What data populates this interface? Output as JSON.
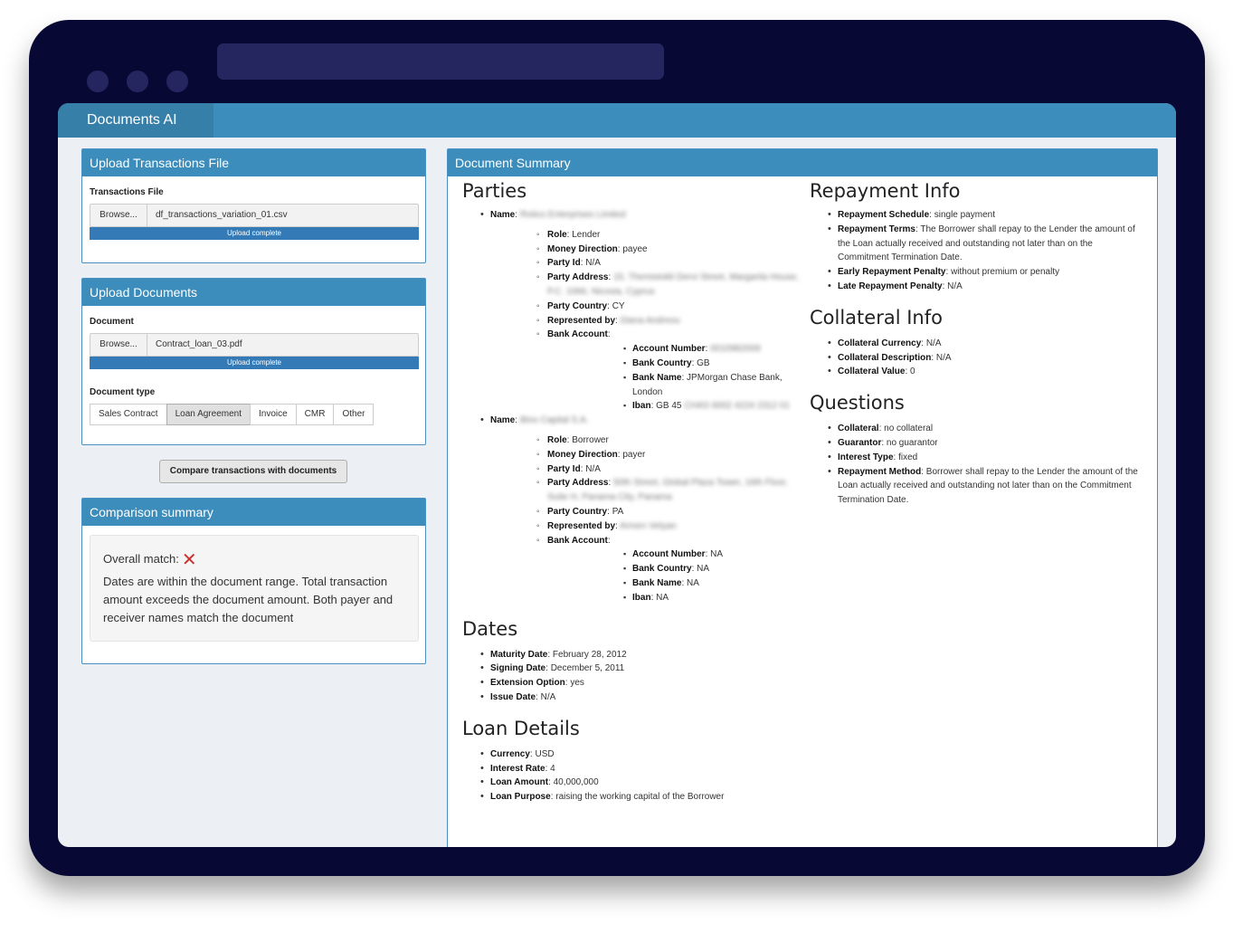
{
  "app": {
    "title": "Documents AI"
  },
  "upload_transactions": {
    "header": "Upload Transactions File",
    "field_label": "Transactions File",
    "browse_label": "Browse...",
    "file_name": "df_transactions_variation_01.csv",
    "progress_text": "Upload complete"
  },
  "upload_documents": {
    "header": "Upload Documents",
    "field_label": "Document",
    "browse_label": "Browse...",
    "file_name": "Contract_loan_03.pdf",
    "progress_text": "Upload complete",
    "type_label": "Document type",
    "types": [
      "Sales Contract",
      "Loan Agreement",
      "Invoice",
      "CMR",
      "Other"
    ],
    "selected_type": "Loan Agreement"
  },
  "compare_button": "Compare transactions with documents",
  "comparison": {
    "header": "Comparison summary",
    "overall_label": "Overall match:",
    "overall_icon": "cross-icon",
    "text": "Dates are within the document range. Total transaction amount exceeds the document amount. Both payer and receiver names match the document"
  },
  "summary": {
    "header": "Document Summary",
    "parties_title": "Parties",
    "party1": {
      "name_key": "Name",
      "name_val": "Rotico Enterprises Limited",
      "role_key": "Role",
      "role_val": "Lender",
      "direction_key": "Money Direction",
      "direction_val": "payee",
      "partyid_key": "Party Id",
      "partyid_val": "N/A",
      "address_key": "Party Address",
      "address_val": "15, Themistokli Dervi Street, Margarita House, P.C. 1066, Nicosia, Cyprus",
      "country_key": "Party Country",
      "country_val": "CY",
      "rep_key": "Represented by",
      "rep_val": "Diana Andreou",
      "bank_key": "Bank Account",
      "acct_key": "Account Number",
      "acct_val": "0010982009",
      "bankcountry_key": "Bank Country",
      "bankcountry_val": "GB",
      "bankname_key": "Bank Name",
      "bankname_val": "JPMorgan Chase Bank, London",
      "iban_key": "Iban",
      "iban_val": "GB 45",
      "iban_hidden": "CHAS 6002 4224 2312 01"
    },
    "party2": {
      "name_key": "Name",
      "name_val": "Bino Capital S.A.",
      "role_key": "Role",
      "role_val": "Borrower",
      "direction_key": "Money Direction",
      "direction_val": "payer",
      "partyid_key": "Party Id",
      "partyid_val": "N/A",
      "address_key": "Party Address",
      "address_val": "50th Street, Global Plaza Tower, 16th Floor, Suite H, Panama City, Panama",
      "country_key": "Party Country",
      "country_val": "PA",
      "rep_key": "Represented by",
      "rep_val": "Armen Vetyan",
      "bank_key": "Bank Account",
      "acct_key": "Account Number",
      "acct_val": "NA",
      "bankcountry_key": "Bank Country",
      "bankcountry_val": "NA",
      "bankname_key": "Bank Name",
      "bankname_val": "NA",
      "iban_key": "Iban",
      "iban_val": "NA"
    },
    "dates_title": "Dates",
    "dates": [
      {
        "k": "Maturity Date",
        "v": "February 28, 2012"
      },
      {
        "k": "Signing Date",
        "v": "December 5, 2011"
      },
      {
        "k": "Extension Option",
        "v": "yes"
      },
      {
        "k": "Issue Date",
        "v": "N/A"
      }
    ],
    "loan_title": "Loan Details",
    "loan": [
      {
        "k": "Currency",
        "v": "USD"
      },
      {
        "k": "Interest Rate",
        "v": "4"
      },
      {
        "k": "Loan Amount",
        "v": "40,000,000"
      },
      {
        "k": "Loan Purpose",
        "v": "raising the working capital of the Borrower"
      }
    ],
    "repay_title": "Repayment Info",
    "repay": [
      {
        "k": "Repayment Schedule",
        "v": "single payment"
      },
      {
        "k": "Repayment Terms",
        "v": "The Borrower shall repay to the Lender the amount of the Loan actually received and outstanding not later than on the Commitment Termination Date."
      },
      {
        "k": "Early Repayment Penalty",
        "v": "without premium or penalty"
      },
      {
        "k": "Late Repayment Penalty",
        "v": "N/A"
      }
    ],
    "collateral_title": "Collateral Info",
    "collateral": [
      {
        "k": "Collateral Currency",
        "v": "N/A"
      },
      {
        "k": "Collateral Description",
        "v": "N/A"
      },
      {
        "k": "Collateral Value",
        "v": "0"
      }
    ],
    "questions_title": "Questions",
    "questions": [
      {
        "k": "Collateral",
        "v": "no collateral"
      },
      {
        "k": "Guarantor",
        "v": "no guarantor"
      },
      {
        "k": "Interest Type",
        "v": "fixed"
      },
      {
        "k": "Repayment Method",
        "v": "Borrower shall repay to the Lender the amount of the Loan actually received and outstanding not later than on the Commitment Termination Date."
      }
    ]
  }
}
